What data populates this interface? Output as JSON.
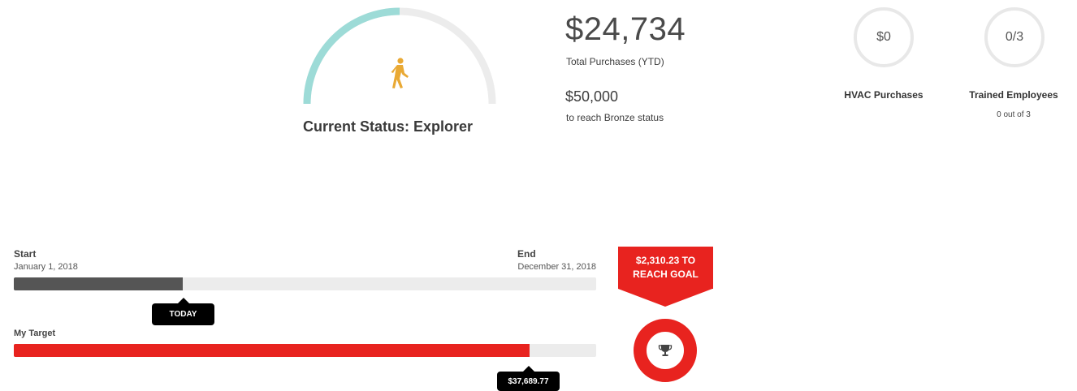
{
  "status": {
    "title": "Current Status: Explorer",
    "icon": "walking-person-icon",
    "progress_fraction": 0.5,
    "arc_color": "#9ddbd7",
    "icon_color": "#e9a934"
  },
  "purchases": {
    "total_amount": "$24,734",
    "total_label": "Total Purchases (YTD)",
    "next_amount": "$50,000",
    "next_label": "to reach Bronze status"
  },
  "stats": [
    {
      "value": "$0",
      "label": "HVAC Purchases",
      "sub": ""
    },
    {
      "value": "0/3",
      "label": "Trained Employees",
      "sub": "0 out of 3"
    }
  ],
  "timeline": {
    "start_label": "Start",
    "start_date": "January 1, 2018",
    "end_label": "End",
    "end_date": "December 31, 2018",
    "today_label": "TODAY",
    "elapsed_fraction": 0.29
  },
  "target": {
    "label": "My Target",
    "value": "$37,689.77",
    "fraction": 0.885,
    "bar_color": "#e8231f"
  },
  "goal": {
    "text": "$2,310.23 TO REACH GOAL",
    "icon": "trophy-icon",
    "color": "#e8231f"
  }
}
